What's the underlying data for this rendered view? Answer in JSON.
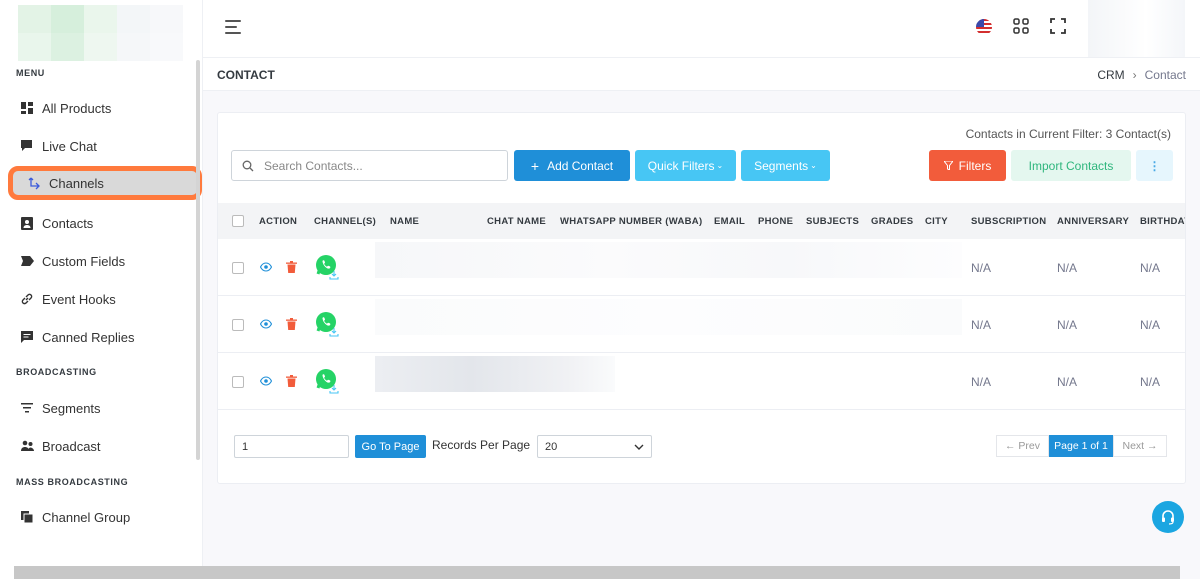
{
  "colors": {
    "primary": "#1f8fd8",
    "info": "#47c6f4",
    "danger": "#f25c3b",
    "success_soft": "#e4f7ef",
    "highlight": "#ff7a3d",
    "whatsapp": "#25d366"
  },
  "sidebar": {
    "sections": [
      {
        "title": "MENU",
        "items": [
          {
            "label": "All Products",
            "icon": "grid-icon"
          },
          {
            "label": "Live Chat",
            "icon": "chat-icon"
          },
          {
            "label": "Channels",
            "icon": "channels-icon",
            "active": true
          },
          {
            "label": "Contacts",
            "icon": "contacts-icon"
          },
          {
            "label": "Custom Fields",
            "icon": "tag-icon"
          },
          {
            "label": "Event Hooks",
            "icon": "link-icon"
          },
          {
            "label": "Canned Replies",
            "icon": "message-icon"
          }
        ]
      },
      {
        "title": "BROADCASTING",
        "items": [
          {
            "label": "Segments",
            "icon": "filter-icon"
          },
          {
            "label": "Broadcast",
            "icon": "people-icon"
          }
        ]
      },
      {
        "title": "MASS BROADCASTING",
        "items": [
          {
            "label": "Channel Group",
            "icon": "copy-icon"
          }
        ]
      }
    ]
  },
  "header": {
    "language": "us-flag-icon"
  },
  "page": {
    "title": "CONTACT",
    "breadcrumb": [
      "CRM",
      "Contact"
    ],
    "filter_count": "Contacts in Current Filter: 3 Contact(s)"
  },
  "toolbar": {
    "search_placeholder": "Search Contacts...",
    "add_contact": "Add Contact",
    "quick_filters": "Quick Filters",
    "segments": "Segments",
    "filters": "Filters",
    "import_contacts": "Import Contacts",
    "more": "⋮"
  },
  "table": {
    "columns": [
      "ACTION",
      "CHANNEL(S)",
      "NAME",
      "CHAT NAME",
      "WHATSAPP NUMBER (WABA)",
      "EMAIL",
      "PHONE",
      "SUBJECTS",
      "GRADES",
      "CITY",
      "SUBSCRIPTION",
      "ANNIVERSARY",
      "BIRTHDAY"
    ],
    "rows": [
      {
        "channel": "whatsapp",
        "subscription": "N/A",
        "anniversary": "N/A",
        "birthday": "N/A"
      },
      {
        "channel": "whatsapp",
        "subscription": "N/A",
        "anniversary": "N/A",
        "birthday": "N/A"
      },
      {
        "channel": "whatsapp",
        "subscription": "N/A",
        "anniversary": "N/A",
        "birthday": "N/A"
      }
    ]
  },
  "pagination": {
    "page_input": "1",
    "goto_label": "Go To Page",
    "records_label": "Records Per Page",
    "records_value": "20",
    "prev": "← Prev",
    "current": "Page 1 of 1",
    "next": "Next →"
  }
}
